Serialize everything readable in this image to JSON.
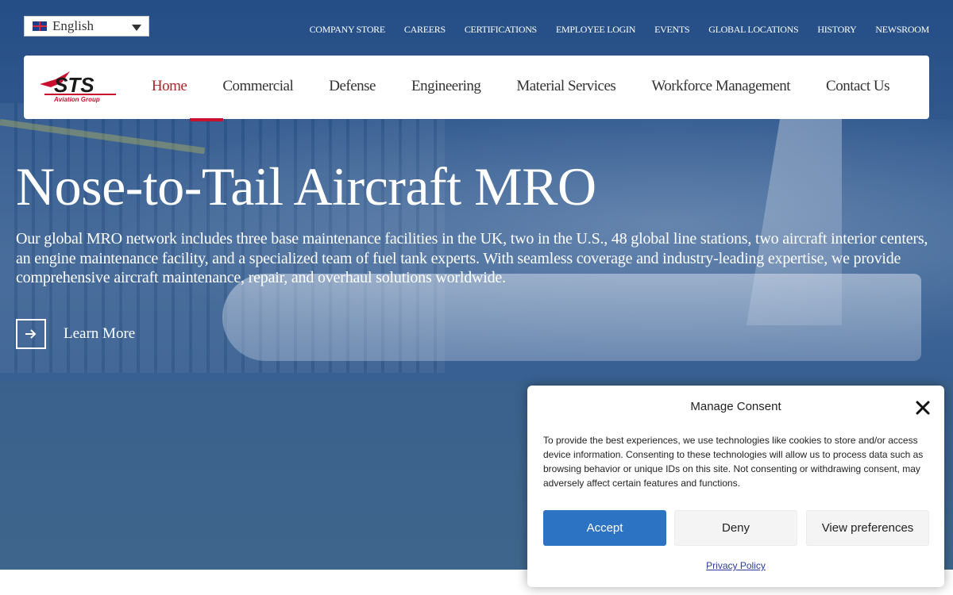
{
  "language": {
    "selected": "English"
  },
  "top_links": [
    "COMPANY STORE",
    "CAREERS",
    "CERTIFICATIONS",
    "EMPLOYEE LOGIN",
    "EVENTS",
    "GLOBAL LOCATIONS",
    "HISTORY",
    "NEWSROOM"
  ],
  "logo": {
    "brand": "STS",
    "sub": "Aviation Group"
  },
  "nav": {
    "active": "Home",
    "items": [
      "Home",
      "Commercial",
      "Defense",
      "Engineering",
      "Material Services",
      "Workforce Management",
      "Contact Us"
    ]
  },
  "hero": {
    "title": "Nose-to-Tail Aircraft MRO",
    "description": "Our global MRO network includes three base maintenance facilities in the UK, two in the U.S., 48 global line stations, two aircraft interior centers, an engine maintenance facility, and a specialized team of fuel tank experts. With seamless coverage and industry-leading expertise, we provide comprehensive aircraft maintenance, repair, and overhaul solutions worldwide.",
    "cta_label": "Learn More"
  },
  "consent": {
    "title": "Manage Consent",
    "text": "To provide the best experiences, we use technologies like cookies to store and/or access device information. Consenting to these technologies will allow us to process data such as browsing behavior or unique IDs on this site. Not consenting or withdrawing consent, may adversely affect certain features and functions.",
    "accept": "Accept",
    "deny": "Deny",
    "preferences": "View preferences",
    "privacy_link": "Privacy Policy"
  },
  "colors": {
    "brand_red": "#c8102e",
    "accept_blue": "#2d73c4",
    "hero_overlay": "#1e4882"
  },
  "icons": {
    "language_flag": "uk-flag-icon",
    "dropdown": "caret-down-icon",
    "cta": "arrow-right-icon",
    "close": "close-icon"
  }
}
